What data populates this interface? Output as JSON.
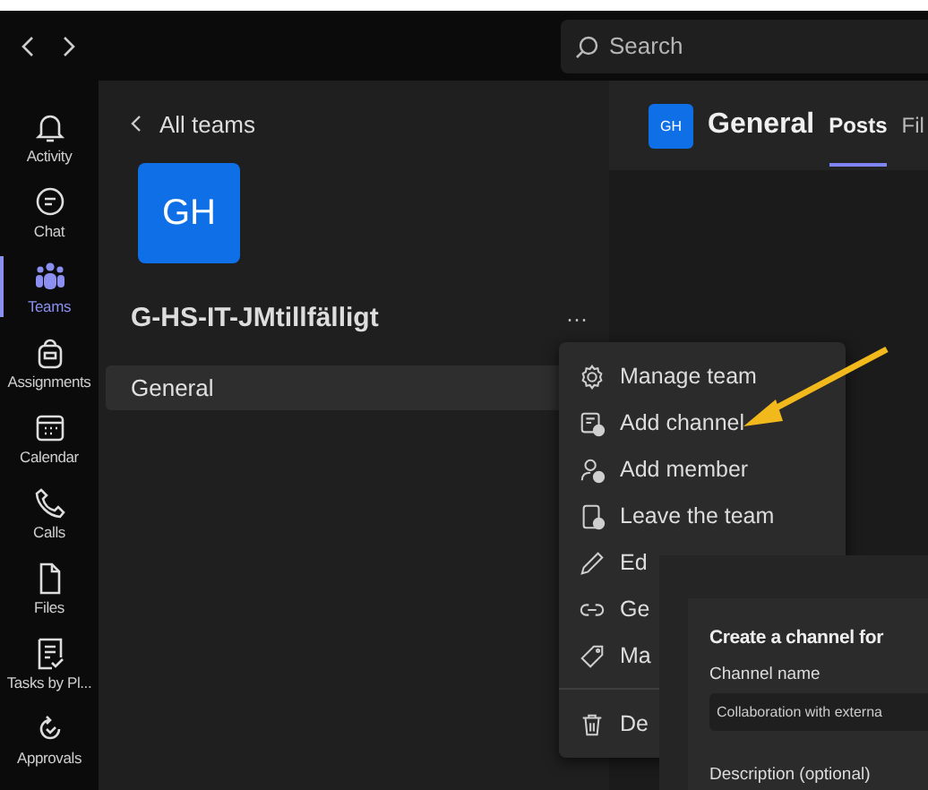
{
  "search": {
    "placeholder": "Search"
  },
  "rail": [
    {
      "label": "Activity",
      "selected": false
    },
    {
      "label": "Chat",
      "selected": false
    },
    {
      "label": "Teams",
      "selected": true
    },
    {
      "label": "Assignments",
      "selected": false
    },
    {
      "label": "Calendar",
      "selected": false
    },
    {
      "label": "Calls",
      "selected": false
    },
    {
      "label": "Files",
      "selected": false
    },
    {
      "label": "Tasks by Pl...",
      "selected": false
    },
    {
      "label": "Approvals",
      "selected": false
    }
  ],
  "team_panel": {
    "back": "All teams",
    "avatar": "GH",
    "team_name": "G-HS-IT-JMtillfälligt",
    "more": "···",
    "channels": [
      {
        "name": "General",
        "selected": true
      }
    ]
  },
  "channel_header": {
    "avatar": "GH",
    "title": "General",
    "tabs": [
      {
        "label": "Posts",
        "selected": true
      },
      {
        "label": "Fil",
        "selected": false
      }
    ]
  },
  "menu": [
    {
      "label": "Manage team",
      "divider": false
    },
    {
      "label": "Add channel",
      "divider": false
    },
    {
      "label": "Add member",
      "divider": false
    },
    {
      "label": "Leave the team",
      "divider": false
    },
    {
      "label": "Ed",
      "divider": false
    },
    {
      "label": "Ge",
      "divider": false
    },
    {
      "label": "Ma",
      "divider": false
    },
    {
      "label": "De",
      "divider": true
    }
  ],
  "dialog": {
    "title": "Create a channel for",
    "name_label": "Channel name",
    "name_value": "Collaboration with externa",
    "description_label": "Description (optional)"
  }
}
